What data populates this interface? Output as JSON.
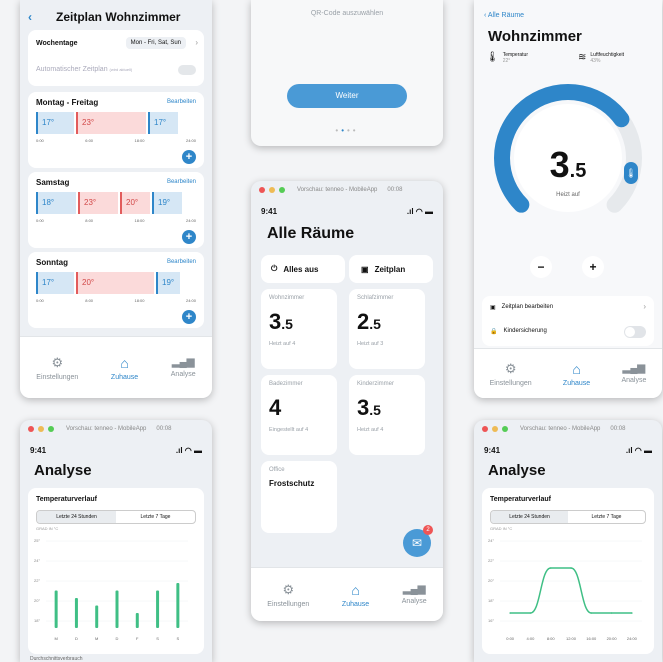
{
  "schedule": {
    "title": "Zeitplan Wohnzimmer",
    "weekdays_label": "Wochentage",
    "weekdays_value": "Mon - Fri, Sat, Sun",
    "auto_label": "Automatischer Zeitplan",
    "auto_sub": "(wird aktuell)",
    "blocks": [
      {
        "title": "Montag - Freitag",
        "edit": "Bearbeiten",
        "slots": [
          "17°",
          "23°",
          "17°"
        ],
        "ticks": [
          "0:00",
          "6:00",
          "18:00",
          "24:00"
        ]
      },
      {
        "title": "Samstag",
        "edit": "Bearbeiten",
        "slots": [
          "18°",
          "23°",
          "20°",
          "19°"
        ],
        "ticks": [
          "0:00",
          "8:00",
          "18:00",
          "24:00"
        ]
      },
      {
        "title": "Sonntag",
        "edit": "Bearbeiten",
        "slots": [
          "17°",
          "20°",
          "19°"
        ],
        "ticks": [
          "0:00",
          "8:00",
          "18:00",
          "24:00"
        ]
      }
    ]
  },
  "tabs": {
    "settings": "Einstellungen",
    "home": "Zuhause",
    "analysis": "Analyse"
  },
  "qr": {
    "hint": "QR-Code auszuwählen",
    "button": "Weiter"
  },
  "living": {
    "back": "Alle Räume",
    "title": "Wohnzimmer",
    "temp_label": "Temperatur",
    "temp_value": "22°",
    "hum_label": "Luftfeuchtigkeit",
    "hum_value": "43%",
    "big": "3",
    "big_dec": ".5",
    "mode": "Heizt auf",
    "minus": "−",
    "plus": "+",
    "plan_edit": "Zeitplan bearbeiten",
    "child_lock": "Kindersicherung",
    "dial_fraction": 0.7
  },
  "rooms": {
    "window_title": "Vorschau: tenneo - MobileApp",
    "window_zoom": "00:08",
    "time": "9:41",
    "title": "Alle Räume",
    "all_off": "Alles aus",
    "plan": "Zeitplan",
    "items": [
      {
        "name": "Wohnzimmer",
        "value": "3",
        "dec": ".5",
        "status": "Heizt auf 4"
      },
      {
        "name": "Schlafzimmer",
        "value": "2",
        "dec": ".5",
        "status": "Heizt auf 3"
      },
      {
        "name": "Badezimmer",
        "value": "4",
        "dec": "",
        "status": "Eingestellt auf 4"
      },
      {
        "name": "Kinderzimmer",
        "value": "3",
        "dec": ".5",
        "status": "Heizt auf 4"
      },
      {
        "name": "Office",
        "value": "Frostschutz",
        "dec": "",
        "status": ""
      }
    ],
    "badge": "2"
  },
  "analysis_left": {
    "window_title": "Vorschau: tenneo - MobileApp",
    "window_zoom": "00:08",
    "time": "9:41",
    "title": "Analyse",
    "chart_title": "Temperaturverlauf",
    "seg_a": "Letzte 24 Stunden",
    "seg_b": "Letzte 7 Tage",
    "unit": "GRAD IN °C",
    "footer": "Durchschnittsverbrauch",
    "chart_data": {
      "type": "bar",
      "categories": [
        "M",
        "D",
        "M",
        "D",
        "F",
        "S",
        "S"
      ],
      "values": [
        19,
        18,
        17,
        19,
        16,
        19,
        20
      ],
      "yticks": [
        "25°",
        "24°",
        "22°",
        "20°",
        "18°"
      ],
      "ylim": [
        14,
        26
      ]
    }
  },
  "analysis_right": {
    "window_title": "Vorschau: tenneo - MobileApp",
    "window_zoom": "00:08",
    "time": "9:41",
    "title": "Analyse",
    "chart_title": "Temperaturverlauf",
    "seg_a": "Letzte 24 Stunden",
    "seg_b": "Letzte 7 Tage",
    "unit": "GRAD IN °C",
    "chart_data": {
      "type": "line",
      "x": [
        "0:00",
        "4:00",
        "8:00",
        "12:00",
        "16:00",
        "20:00",
        "24:00"
      ],
      "values": [
        16,
        16,
        22,
        22,
        16,
        16,
        16
      ],
      "yticks": [
        "24°",
        "22°",
        "20°",
        "18°",
        "16°"
      ],
      "ylim": [
        14,
        26
      ]
    }
  },
  "colors": {
    "accent": "#2e86c9",
    "warm": "#e25c5c",
    "green": "#3fbf85"
  }
}
